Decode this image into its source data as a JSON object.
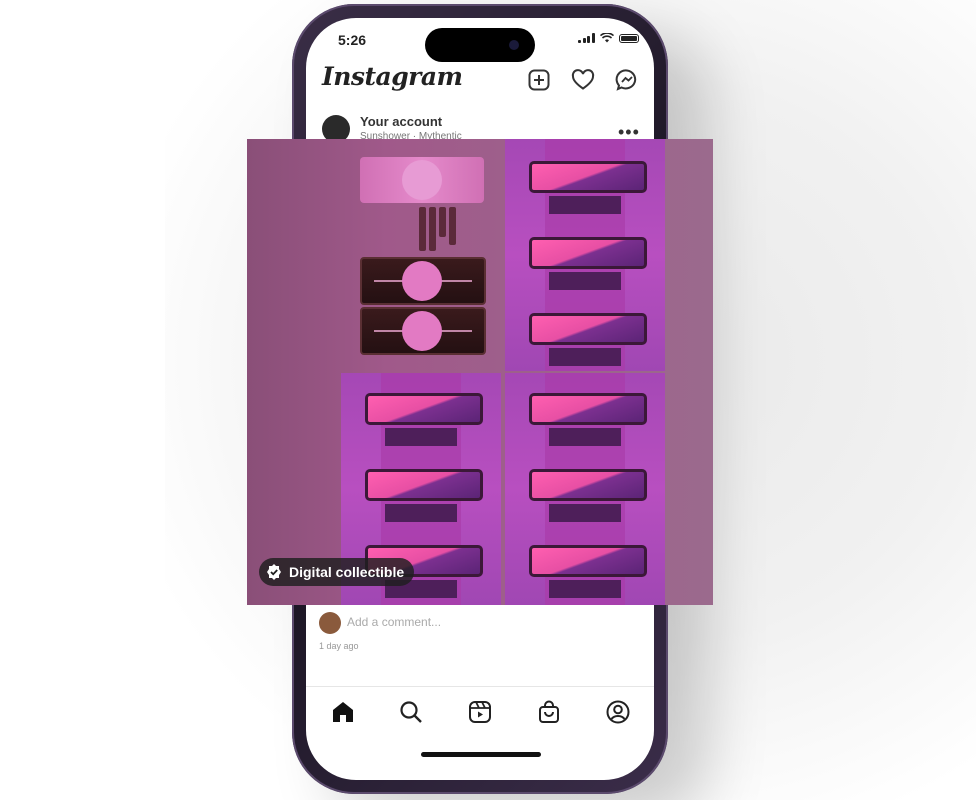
{
  "status_bar": {
    "time": "5:26"
  },
  "header": {
    "logo": "Instagram"
  },
  "post": {
    "account_name": "Your account",
    "account_subtitle": "Sunshower · Mythentic",
    "more_label": "•••",
    "badge_label": "Digital collectible"
  },
  "comment": {
    "placeholder": "Add a comment...",
    "time_ago": "1 day ago"
  },
  "icons": {
    "top": [
      "new-post-icon",
      "heart-icon",
      "messenger-icon"
    ],
    "nav": [
      "home-icon",
      "search-icon",
      "reels-icon",
      "shop-icon",
      "profile-icon"
    ]
  },
  "colors": {
    "phone_frame": "#2a2036",
    "badge_bg": "#1e1e1e",
    "art_magenta": "#b84fc0"
  }
}
